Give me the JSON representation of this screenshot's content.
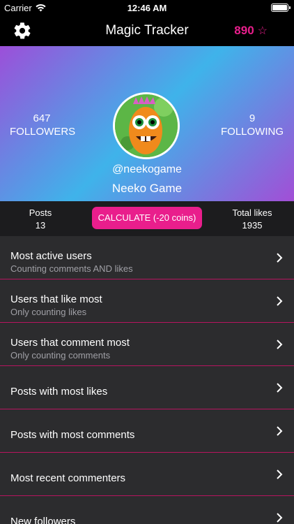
{
  "status": {
    "carrier": "Carrier",
    "time": "12:46 AM"
  },
  "nav": {
    "title": "Magic Tracker",
    "coins": "890",
    "coin_icon": "star-icon"
  },
  "profile": {
    "followers_count": "647",
    "followers_label": "FOLLOWERS",
    "following_count": "9",
    "following_label": "FOLLOWING",
    "handle": "@neekogame",
    "name": "Neeko Game"
  },
  "stats": {
    "posts_label": "Posts",
    "posts_value": "13",
    "calculate_label": "CALCULATE (-20 coins)",
    "likes_label": "Total likes",
    "likes_value": "1935"
  },
  "menu": [
    {
      "label": "Most active users",
      "sub": "Counting comments AND likes"
    },
    {
      "label": "Users that like most",
      "sub": "Only counting likes"
    },
    {
      "label": "Users that comment most",
      "sub": "Only counting comments"
    },
    {
      "label": "Posts with most likes",
      "sub": ""
    },
    {
      "label": "Posts with most comments",
      "sub": ""
    },
    {
      "label": "Most recent commenters",
      "sub": ""
    },
    {
      "label": "New followers",
      "sub": ""
    }
  ],
  "colors": {
    "accent": "#e91e8c",
    "list_bg": "#2c2c2e",
    "separator": "#b8155f"
  }
}
